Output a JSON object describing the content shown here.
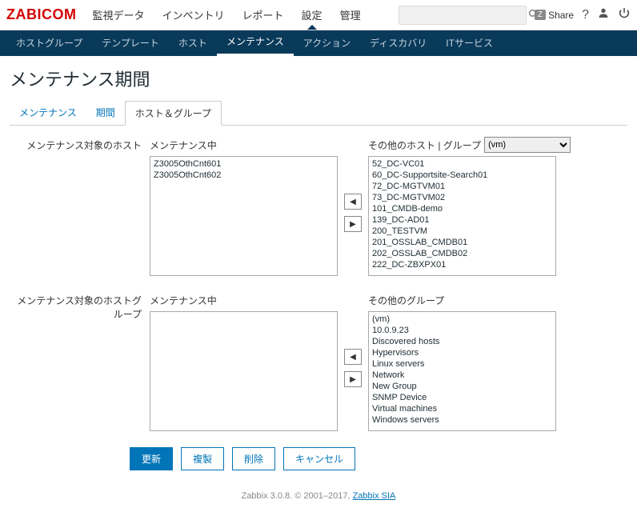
{
  "logo": "ZABICOM",
  "topnav": [
    "監視データ",
    "インベントリ",
    "レポート",
    "設定",
    "管理"
  ],
  "topnav_active": 3,
  "search_placeholder": "",
  "share_label": "Share",
  "subnav": [
    "ホストグループ",
    "テンプレート",
    "ホスト",
    "メンテナンス",
    "アクション",
    "ディスカバリ",
    "ITサービス"
  ],
  "subnav_active": 3,
  "page_title": "メンテナンス期間",
  "tabs": [
    "メンテナンス",
    "期間",
    "ホスト＆グループ"
  ],
  "tabs_active": 2,
  "hosts_section": {
    "row_label": "メンテナンス対象のホスト",
    "in_label": "メンテナンス中",
    "other_label": "その他のホスト | グループ",
    "group_selected": "(vm)",
    "in_items": [
      "Z3005OthCnt601",
      "Z3005OthCnt602"
    ],
    "other_items": [
      "52_DC-VC01",
      "60_DC-Supportsite-Search01",
      "72_DC-MGTVM01",
      "73_DC-MGTVM02",
      "101_CMDB-demo",
      "139_DC-AD01",
      "200_TESTVM",
      "201_OSSLAB_CMDB01",
      "202_OSSLAB_CMDB02",
      "222_DC-ZBXPX01"
    ]
  },
  "groups_section": {
    "row_label": "メンテナンス対象のホストグループ",
    "in_label": "メンテナンス中",
    "other_label": "その他のグループ",
    "in_items": [],
    "other_items": [
      "(vm)",
      "10.0.9.23",
      "Discovered hosts",
      "Hypervisors",
      "Linux servers",
      "Network",
      "New Group",
      "SNMP Device",
      "Virtual machines",
      "Windows servers"
    ]
  },
  "buttons": {
    "update": "更新",
    "clone": "複製",
    "delete": "削除",
    "cancel": "キャンセル"
  },
  "footer": {
    "prefix": "Zabbix 3.0.8. © 2001–2017, ",
    "link": "Zabbix SIA"
  }
}
